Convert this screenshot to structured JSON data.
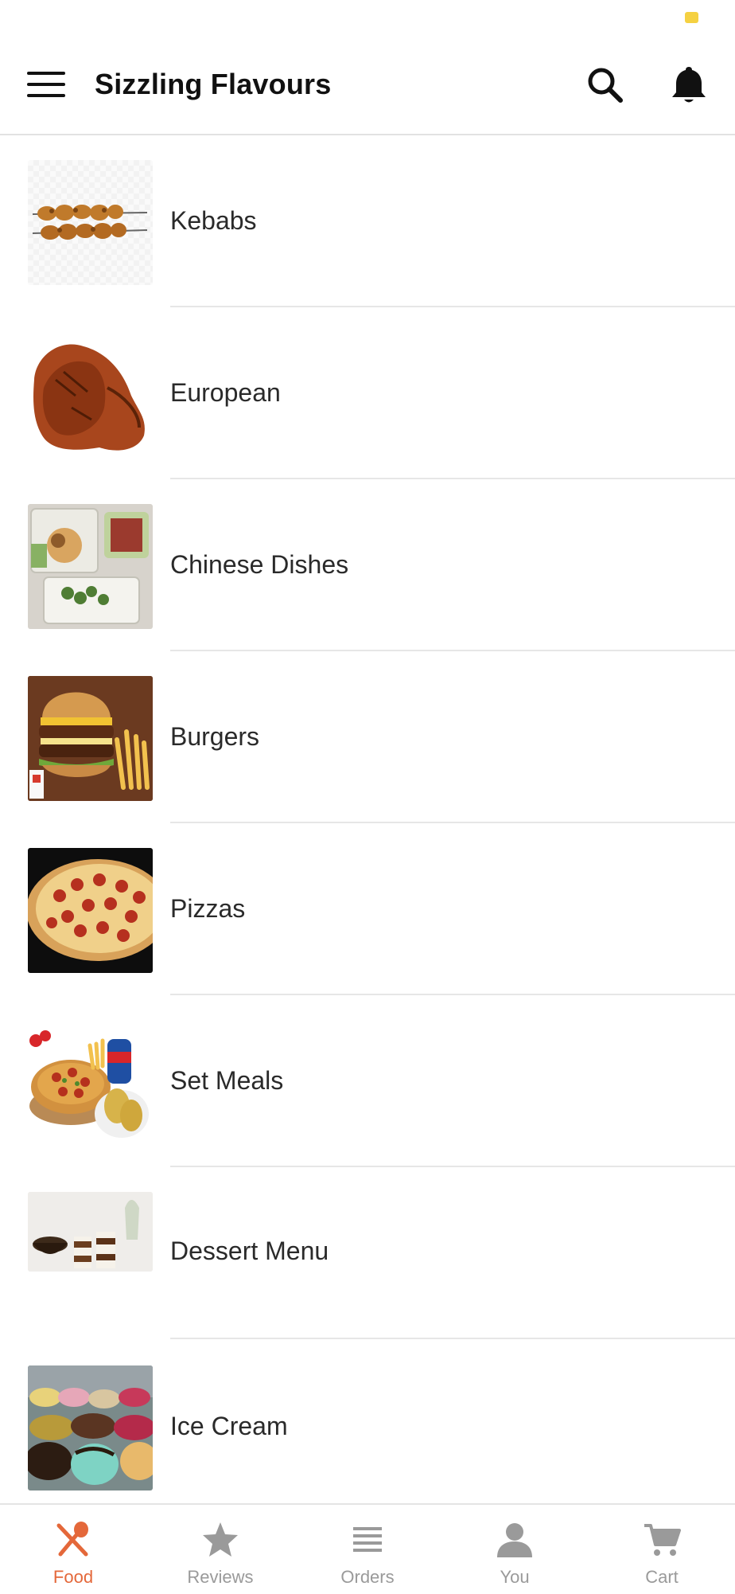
{
  "app_bar": {
    "title": "Sizzling Flavours",
    "menu_icon": "hamburger-menu-icon",
    "search_icon": "search-icon",
    "notification_icon": "bell-icon"
  },
  "categories": [
    {
      "label": "Kebabs",
      "image": "kebab-skewers-image"
    },
    {
      "label": "European",
      "image": "roast-chicken-image"
    },
    {
      "label": "Chinese Dishes",
      "image": "takeaway-boxes-image"
    },
    {
      "label": "Burgers",
      "image": "burger-fries-image"
    },
    {
      "label": "Pizzas",
      "image": "pepperoni-pizza-image"
    },
    {
      "label": "Set Meals",
      "image": "pizza-meal-image"
    },
    {
      "label": "Dessert Menu",
      "image": "dessert-cups-image"
    },
    {
      "label": "Ice Cream",
      "image": "ice-cream-tubs-image"
    }
  ],
  "bottom_nav": [
    {
      "label": "Food",
      "icon": "fork-spoon-icon",
      "active": true
    },
    {
      "label": "Reviews",
      "icon": "star-icon",
      "active": false
    },
    {
      "label": "Orders",
      "icon": "list-icon",
      "active": false
    },
    {
      "label": "You",
      "icon": "person-icon",
      "active": false
    },
    {
      "label": "Cart",
      "icon": "cart-icon",
      "active": false
    }
  ],
  "colors": {
    "accent": "#e4683a",
    "inactive": "#9a9a9a",
    "status_indicator": "#f5d142"
  }
}
